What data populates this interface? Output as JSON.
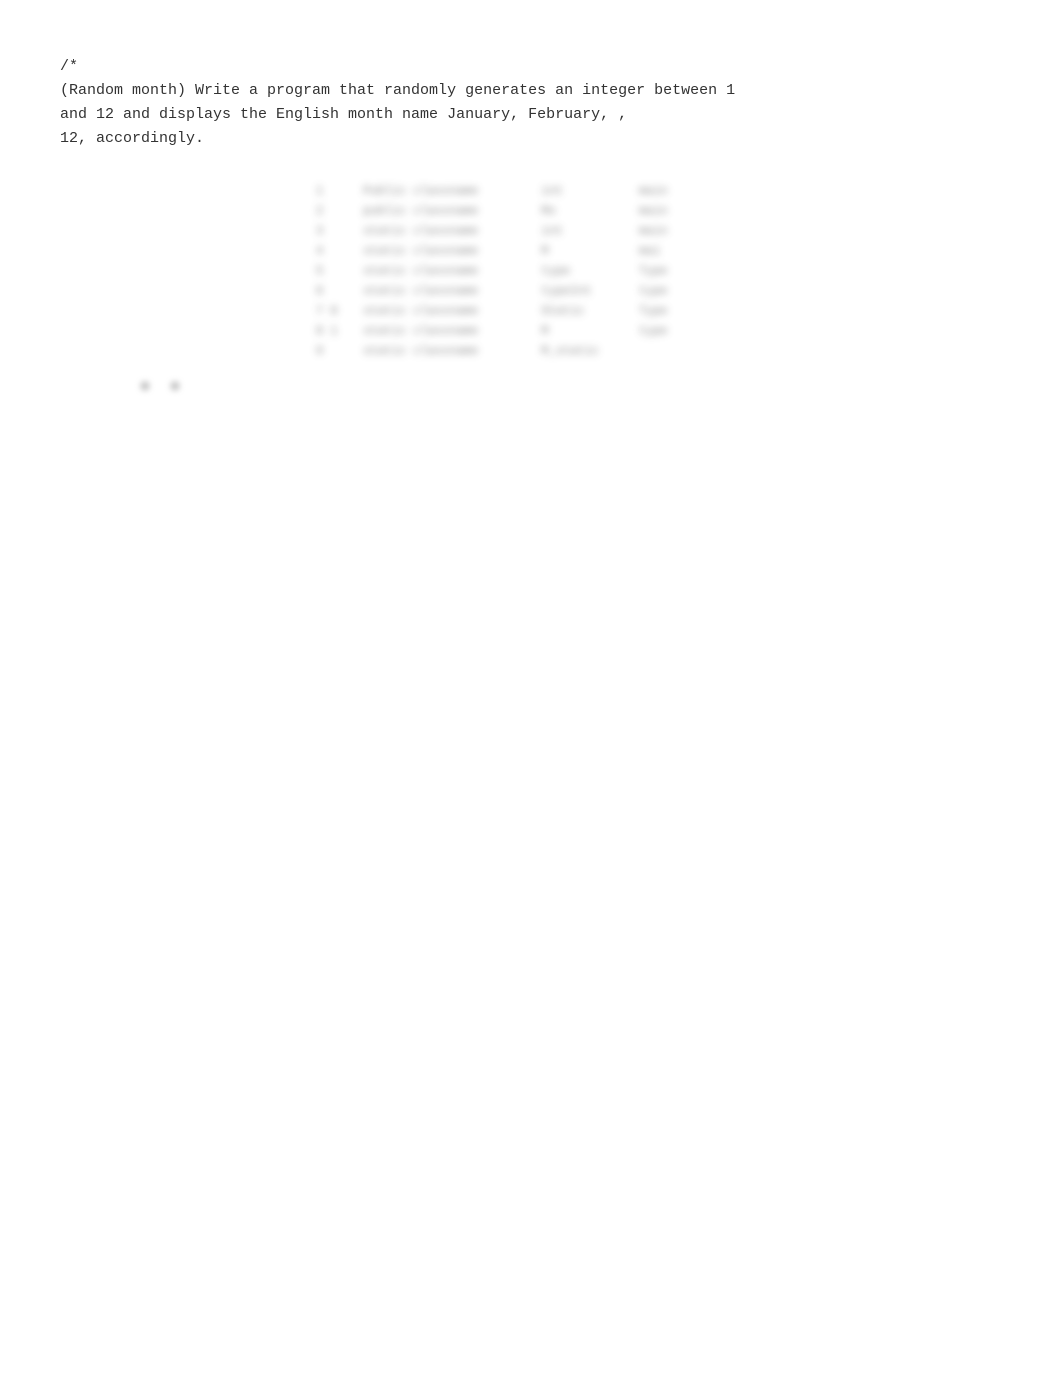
{
  "comment": {
    "opener": "/*",
    "line1": "(Random month) Write a program that randomly generates an integer between 1",
    "line2": "and 12 and displays the English month name January, February, ,",
    "line3": "12, accordingly."
  },
  "blurred_table": {
    "rows": [
      [
        "1",
        "█████ ████████",
        "███",
        "████"
      ],
      [
        "2",
        "█████ ████████",
        "██",
        "████"
      ],
      [
        "3",
        "█████ ████████",
        "███",
        "████"
      ],
      [
        "4",
        "█████ ████████",
        "██",
        "███"
      ],
      [
        "5",
        "█████ ████████",
        "████",
        "████"
      ],
      [
        "6",
        "█████ ████████",
        "███████",
        "████"
      ],
      [
        "7",
        "██ ██ █████ ████████",
        "██████",
        "████"
      ],
      [
        "8",
        "█ █",
        "█████ ████████",
        "██",
        "████"
      ],
      [
        "9",
        "█ █",
        "█████ ████████",
        "██████"
      ]
    ]
  }
}
